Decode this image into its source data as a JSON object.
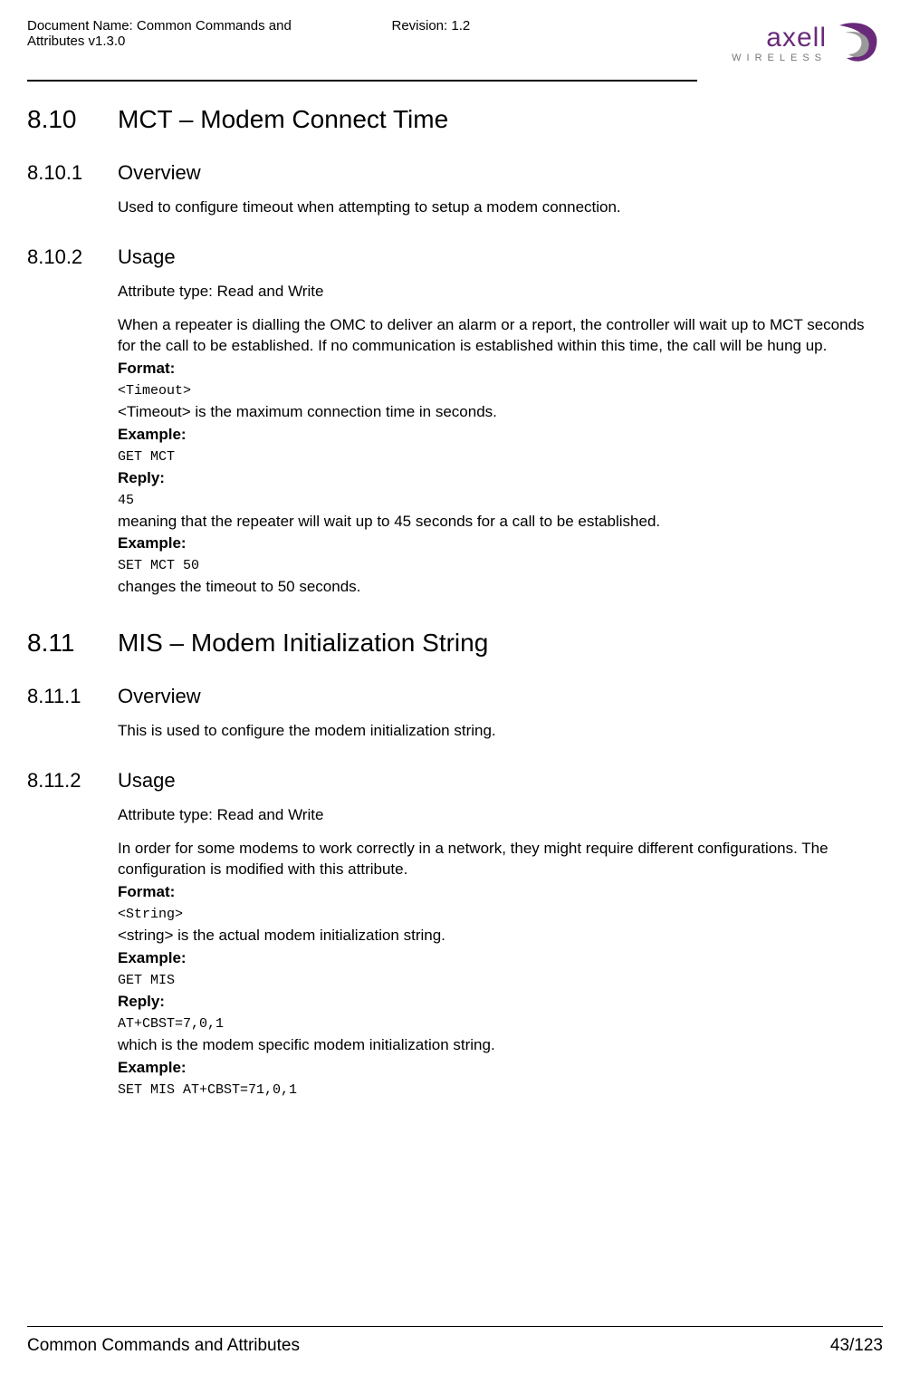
{
  "header": {
    "doc_name": "Document Name: Common Commands and Attributes v1.3.0",
    "revision": "Revision: 1.2",
    "logo_main": "axell",
    "logo_sub": "WIRELESS"
  },
  "sec810": {
    "num": "8.10",
    "title": "MCT – Modem Connect Time"
  },
  "sec8101": {
    "num": "8.10.1",
    "title": "Overview",
    "p1": "Used to configure timeout when attempting to setup a modem connection."
  },
  "sec8102": {
    "num": "8.10.2",
    "title": "Usage",
    "attr": "Attribute type: Read and Write",
    "p1": "When a repeater is dialling the OMC to deliver an alarm or a report, the controller will wait up to MCT seconds for the call to be established. If no communication is established within this time, the call will be hung up.",
    "format_lbl": "Format:",
    "format_val": "<Timeout>",
    "p2": "<Timeout> is the maximum connection time in seconds.",
    "example1_lbl": "Example:",
    "example1_val": "GET MCT",
    "reply_lbl": "Reply:",
    "reply_val": "45",
    "p3": "meaning that the repeater will wait up to 45 seconds for a call to be established.",
    "example2_lbl": "Example:",
    "example2_val": "SET MCT 50",
    "p4": "changes the timeout to 50 seconds."
  },
  "sec811": {
    "num": "8.11",
    "title": "MIS – Modem Initialization String"
  },
  "sec8111": {
    "num": "8.11.1",
    "title": "Overview",
    "p1": "This is used to configure the modem initialization string."
  },
  "sec8112": {
    "num": "8.11.2",
    "title": "Usage",
    "attr": "Attribute type: Read and Write",
    "p1": "In order for some modems to work correctly in a network, they might require different configurations. The configuration is modified with this attribute.",
    "format_lbl": "Format:",
    "format_val": "<String>",
    "p2": "<string> is the actual modem initialization string.",
    "example1_lbl": "Example:",
    "example1_val": "GET MIS",
    "reply_lbl": "Reply:",
    "reply_val": "AT+CBST=7,0,1",
    "p3": "which is the modem specific modem initialization string.",
    "example2_lbl": "Example:",
    "example2_val": "SET MIS AT+CBST=71,0,1"
  },
  "footer": {
    "left": "Common Commands and Attributes",
    "right": "43/123"
  }
}
